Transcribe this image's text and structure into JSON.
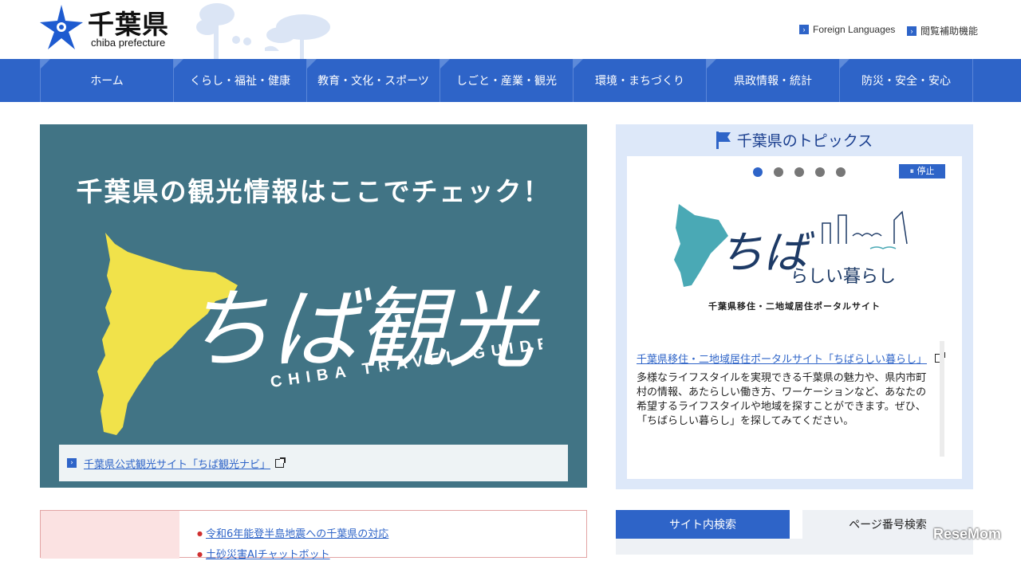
{
  "header": {
    "title": "千葉県",
    "subtitle": "chiba prefecture",
    "links": [
      {
        "label": "Foreign Languages"
      },
      {
        "label": "閲覧補助機能"
      }
    ]
  },
  "nav": [
    {
      "label": "ホーム"
    },
    {
      "label": "くらし・福祉・健康"
    },
    {
      "label": "教育・文化・スポーツ"
    },
    {
      "label": "しごと・産業・観光"
    },
    {
      "label": "環境・まちづくり"
    },
    {
      "label": "県政情報・統計"
    },
    {
      "label": "防災・安全・安心"
    }
  ],
  "banner": {
    "headline": "千葉県の観光情報はここでチェック！",
    "logo_text": "ちば観光ナビ",
    "logo_sub": "CHIBA TRAVEL GUIDE",
    "link": "千葉県公式観光サイト「ちば観光ナビ」"
  },
  "topics": {
    "title": "千葉県のトピックス",
    "pause_label": "停止",
    "slide_count": 5,
    "active_slide": 1,
    "image_text": "ちばらしい暮らし",
    "image_caption": "千葉県移住・二地域居住ポータルサイト",
    "link": "千葉県移住・二地域居住ポータルサイト「ちばらしい暮らし」",
    "description": "多様なライフスタイルを実現できる千葉県の魅力や、県内市町村の情報、あたらしい働き方、ワーケーションなど、あなたの希望するライフスタイルや地域を探すことができます。ぜひ、「ちばらしい暮らし」を探してみてください。"
  },
  "notices": [
    {
      "label": "令和6年能登半島地震への千葉県の対応"
    },
    {
      "label": "土砂災害AIチャットボット"
    }
  ],
  "search": {
    "tabs": [
      {
        "label": "サイト内検索"
      },
      {
        "label": "ページ番号検索"
      }
    ]
  },
  "watermark": "ReseMom",
  "colors": {
    "nav_blue": "#2e64c8",
    "banner_teal": "#417485",
    "map_yellow": "#f1e24a",
    "topics_bg": "#dde8f9"
  }
}
